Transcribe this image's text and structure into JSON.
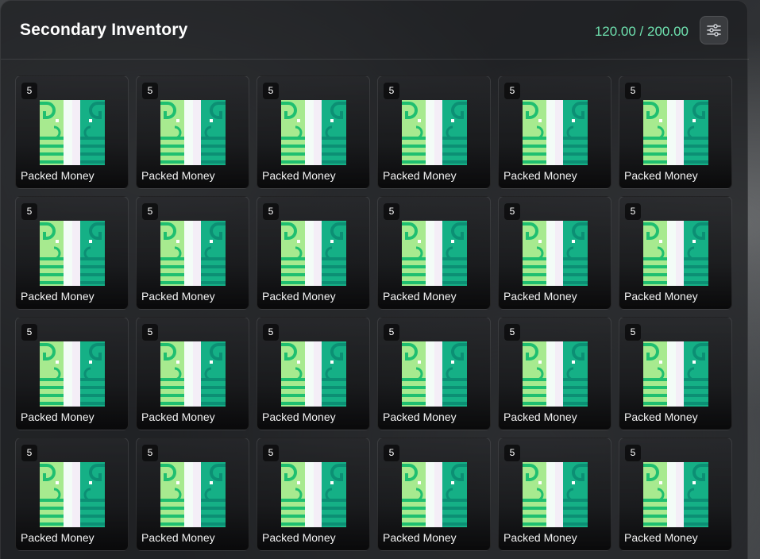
{
  "inventory": {
    "title": "Secondary Inventory",
    "weight": "120.00 / 200.00",
    "settings_icon": "sliders-icon",
    "accent_color": "#6fe3b0",
    "item_icon": "money-stack-icon",
    "slots": [
      {
        "label": "Packed Money",
        "count": "5"
      },
      {
        "label": "Packed Money",
        "count": "5"
      },
      {
        "label": "Packed Money",
        "count": "5"
      },
      {
        "label": "Packed Money",
        "count": "5"
      },
      {
        "label": "Packed Money",
        "count": "5"
      },
      {
        "label": "Packed Money",
        "count": "5"
      },
      {
        "label": "Packed Money",
        "count": "5"
      },
      {
        "label": "Packed Money",
        "count": "5"
      },
      {
        "label": "Packed Money",
        "count": "5"
      },
      {
        "label": "Packed Money",
        "count": "5"
      },
      {
        "label": "Packed Money",
        "count": "5"
      },
      {
        "label": "Packed Money",
        "count": "5"
      },
      {
        "label": "Packed Money",
        "count": "5"
      },
      {
        "label": "Packed Money",
        "count": "5"
      },
      {
        "label": "Packed Money",
        "count": "5"
      },
      {
        "label": "Packed Money",
        "count": "5"
      },
      {
        "label": "Packed Money",
        "count": "5"
      },
      {
        "label": "Packed Money",
        "count": "5"
      },
      {
        "label": "Packed Money",
        "count": "5"
      },
      {
        "label": "Packed Money",
        "count": "5"
      },
      {
        "label": "Packed Money",
        "count": "5"
      },
      {
        "label": "Packed Money",
        "count": "5"
      },
      {
        "label": "Packed Money",
        "count": "5"
      },
      {
        "label": "Packed Money",
        "count": "5"
      }
    ]
  }
}
